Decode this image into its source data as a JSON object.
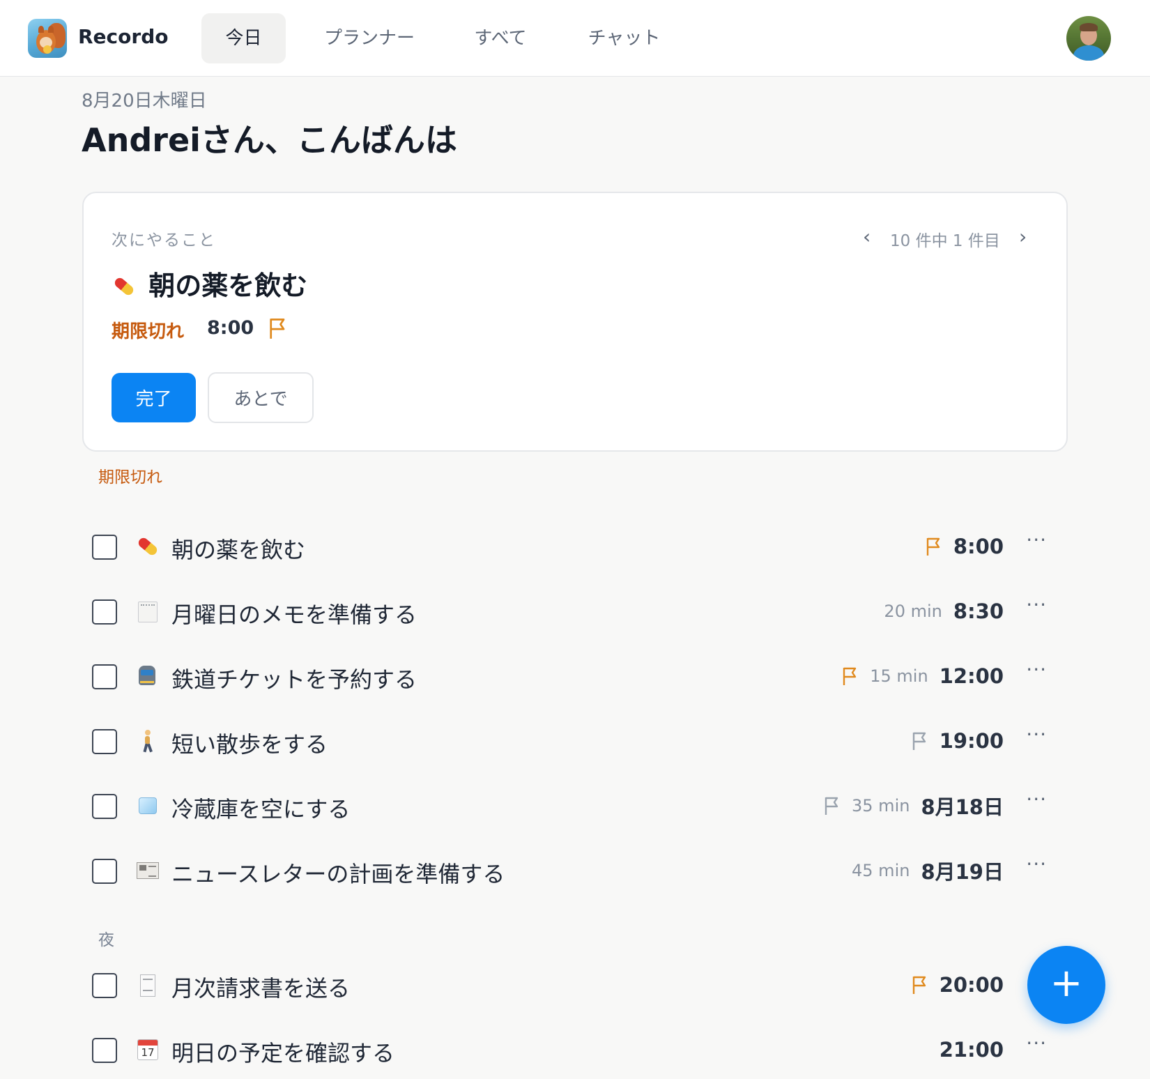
{
  "app": {
    "name": "Recordo"
  },
  "nav": {
    "tabs": [
      {
        "label": "今日",
        "active": true
      },
      {
        "label": "プランナー",
        "active": false
      },
      {
        "label": "すべて",
        "active": false
      },
      {
        "label": "チャット",
        "active": false
      }
    ]
  },
  "header": {
    "date": "8月20日木曜日",
    "greeting": "Andreiさん、こんばんは"
  },
  "next_card": {
    "label": "次にやること",
    "pager": {
      "prev": "‹",
      "text": "10 件中 1 件目",
      "next": "›"
    },
    "emoji": "pill-icon",
    "title": "朝の薬を飲む",
    "status": "期限切れ",
    "time": "8:00",
    "done_label": "完了",
    "later_label": "あとで"
  },
  "sections": [
    {
      "label": "期限切れ",
      "color": "#c65a0e",
      "tasks": [
        {
          "emoji": "pill-icon",
          "title": "朝の薬を飲む",
          "flag": "orange",
          "duration": "",
          "time": "8:00",
          "more": "···"
        },
        {
          "emoji": "memo-icon",
          "title": "月曜日のメモを準備する",
          "flag": "",
          "duration": "20 min",
          "time": "8:30",
          "more": "···"
        },
        {
          "emoji": "train-icon",
          "title": "鉄道チケットを予約する",
          "flag": "orange",
          "duration": "15 min",
          "time": "12:00",
          "more": "···"
        },
        {
          "emoji": "walking-person-icon",
          "title": "短い散歩をする",
          "flag": "gray",
          "duration": "",
          "time": "19:00",
          "more": "···"
        },
        {
          "emoji": "ice-cube-icon",
          "title": "冷蔵庫を空にする",
          "flag": "gray",
          "duration": "35 min",
          "time": "8月18日",
          "more": "···"
        },
        {
          "emoji": "newspaper-icon",
          "title": "ニュースレターの計画を準備する",
          "flag": "",
          "duration": "45 min",
          "time": "8月19日",
          "more": "···"
        }
      ]
    },
    {
      "label": "夜",
      "color": "#7a8494",
      "tasks": [
        {
          "emoji": "receipt-icon",
          "title": "月次請求書を送る",
          "flag": "orange",
          "duration": "",
          "time": "20:00",
          "more": ""
        },
        {
          "emoji": "calendar-icon",
          "title": "明日の予定を確認する",
          "flag": "",
          "duration": "",
          "time": "21:00",
          "more": "···",
          "calendar_day": "17"
        }
      ]
    }
  ],
  "fab": {
    "label": "+"
  },
  "colors": {
    "accent": "#0b84f3",
    "overdue": "#c65a0e",
    "flag_orange": "#e08a1e",
    "flag_gray": "#9aa3ae"
  }
}
